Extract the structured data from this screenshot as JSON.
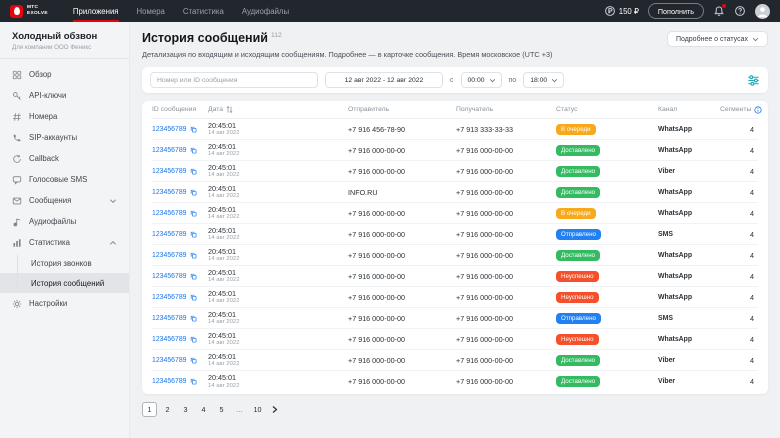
{
  "topbar": {
    "logo_line1": "МТС",
    "logo_line2": "EXOLVE",
    "nav": [
      {
        "label": "Приложения",
        "active": true
      },
      {
        "label": "Номера",
        "active": false
      },
      {
        "label": "Статистика",
        "active": false
      },
      {
        "label": "Аудиофайлы",
        "active": false
      }
    ],
    "balance": "150 ₽",
    "topup_label": "Пополнить"
  },
  "sidebar": {
    "project_title": "Холодный обзвон",
    "project_subtitle": "Для компании ООО Феникс",
    "items": [
      {
        "label": "Обзор"
      },
      {
        "label": "API-ключи"
      },
      {
        "label": "Номера"
      },
      {
        "label": "SIP-аккаунты"
      },
      {
        "label": "Callback"
      },
      {
        "label": "Голосовые SMS"
      },
      {
        "label": "Сообщения"
      },
      {
        "label": "Аудиофайлы"
      },
      {
        "label": "Статистика",
        "expanded": true,
        "children": [
          {
            "label": "История звонков",
            "active": false
          },
          {
            "label": "История сообщений",
            "active": true
          }
        ]
      },
      {
        "label": "Настройки"
      }
    ]
  },
  "main": {
    "title": "История сообщений",
    "count": "112",
    "statuses_button_label": "Подробнее о статусах",
    "subtitle": "Детализация по входящим и исходящим сообщениям. Подробнее — в карточке сообщения. Время московское (UTC +3)",
    "filters": {
      "search_placeholder": "Номер или ID сообщения",
      "date_range": "12 авг 2022 - 12 авг 2022",
      "time_from_label": "с",
      "time_from": "00:00",
      "time_to_label": "по",
      "time_to": "18:00"
    },
    "status_colors": {
      "В очереди": "#F7A81B",
      "Доставлено": "#34BA60",
      "Отправлено": "#2180F2",
      "Неуспешно": "#F4502C"
    },
    "table": {
      "columns": [
        "ID сообщения",
        "Дата",
        "Отправитель",
        "Получатель",
        "Статус",
        "Канал",
        "Сегменты"
      ],
      "rows": [
        {
          "id": "123456789",
          "time": "20:45:01",
          "date": "14 авг 2022",
          "sender": "+7 916 456-78-90",
          "recipient": "+7 913 333-33-33",
          "status": "В очереди",
          "channel": "WhatsApp",
          "segments": "4"
        },
        {
          "id": "123456789",
          "time": "20:45:01",
          "date": "14 авг 2022",
          "sender": "+7 916 000-00-00",
          "recipient": "+7 916 000-00-00",
          "status": "Доставлено",
          "channel": "WhatsApp",
          "segments": "4"
        },
        {
          "id": "123456789",
          "time": "20:45:01",
          "date": "14 авг 2022",
          "sender": "+7 916 000-00-00",
          "recipient": "+7 916 000-00-00",
          "status": "Доставлено",
          "channel": "Viber",
          "segments": "4"
        },
        {
          "id": "123456789",
          "time": "20:45:01",
          "date": "14 авг 2022",
          "sender": "INFO.RU",
          "recipient": "+7 916 000-00-00",
          "status": "Доставлено",
          "channel": "WhatsApp",
          "segments": "4"
        },
        {
          "id": "123456789",
          "time": "20:45:01",
          "date": "14 авг 2022",
          "sender": "+7 916 000-00-00",
          "recipient": "+7 916 000-00-00",
          "status": "В очереди",
          "channel": "WhatsApp",
          "segments": "4"
        },
        {
          "id": "123456789",
          "time": "20:45:01",
          "date": "14 авг 2022",
          "sender": "+7 916 000-00-00",
          "recipient": "+7 916 000-00-00",
          "status": "Отправлено",
          "channel": "SMS",
          "segments": "4"
        },
        {
          "id": "123456789",
          "time": "20:45:01",
          "date": "14 авг 2022",
          "sender": "+7 916 000-00-00",
          "recipient": "+7 916 000-00-00",
          "status": "Доставлено",
          "channel": "WhatsApp",
          "segments": "4"
        },
        {
          "id": "123456789",
          "time": "20:45:01",
          "date": "14 авг 2022",
          "sender": "+7 916 000-00-00",
          "recipient": "+7 916 000-00-00",
          "status": "Неуспешно",
          "channel": "WhatsApp",
          "segments": "4"
        },
        {
          "id": "123456789",
          "time": "20:45:01",
          "date": "14 авг 2022",
          "sender": "+7 916 000-00-00",
          "recipient": "+7 916 000-00-00",
          "status": "Неуспешно",
          "channel": "WhatsApp",
          "segments": "4"
        },
        {
          "id": "123456789",
          "time": "20:45:01",
          "date": "14 авг 2022",
          "sender": "+7 916 000-00-00",
          "recipient": "+7 916 000-00-00",
          "status": "Отправлено",
          "channel": "SMS",
          "segments": "4"
        },
        {
          "id": "123456789",
          "time": "20:45:01",
          "date": "14 авг 2022",
          "sender": "+7 916 000-00-00",
          "recipient": "+7 916 000-00-00",
          "status": "Неуспешно",
          "channel": "WhatsApp",
          "segments": "4"
        },
        {
          "id": "123456789",
          "time": "20:45:01",
          "date": "14 авг 2022",
          "sender": "+7 916 000-00-00",
          "recipient": "+7 916 000-00-00",
          "status": "Доставлено",
          "channel": "Viber",
          "segments": "4"
        },
        {
          "id": "123456789",
          "time": "20:45:01",
          "date": "14 авг 2022",
          "sender": "+7 916 000-00-00",
          "recipient": "+7 916 000-00-00",
          "status": "Доставлено",
          "channel": "Viber",
          "segments": "4"
        }
      ]
    },
    "pagination": {
      "pages": [
        "1",
        "2",
        "3",
        "4",
        "5",
        "…",
        "10"
      ],
      "active": "1"
    }
  },
  "colors": {
    "brand_red": "#E30611",
    "link_blue": "#1A75E8",
    "filter_icon_teal": "#1FA7B5"
  }
}
